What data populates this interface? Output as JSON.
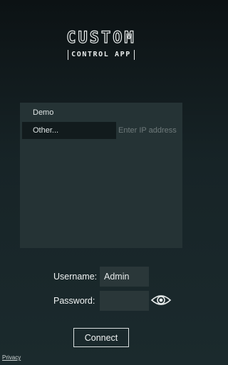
{
  "app": {
    "logo_top": "CUSTOM",
    "logo_bottom": "CONTROL APP"
  },
  "connections": {
    "items": [
      {
        "label": "Demo"
      },
      {
        "label": "Other..."
      }
    ],
    "ip_placeholder": "Enter IP address",
    "ip_value": ""
  },
  "login": {
    "username_label": "Username:",
    "username_value": "Admin",
    "password_label": "Password:",
    "password_value": "",
    "show_password_icon": "eye-icon"
  },
  "actions": {
    "connect_label": "Connect"
  },
  "footer": {
    "privacy_label": "Privacy"
  },
  "colors": {
    "background_top": "#0c1214",
    "background_bottom": "#1b2a2d",
    "panel": "#253335",
    "selected_row": "#121b1d",
    "field": "#2a3739",
    "text": "#f0f3f3",
    "placeholder": "#6f7a7b"
  }
}
